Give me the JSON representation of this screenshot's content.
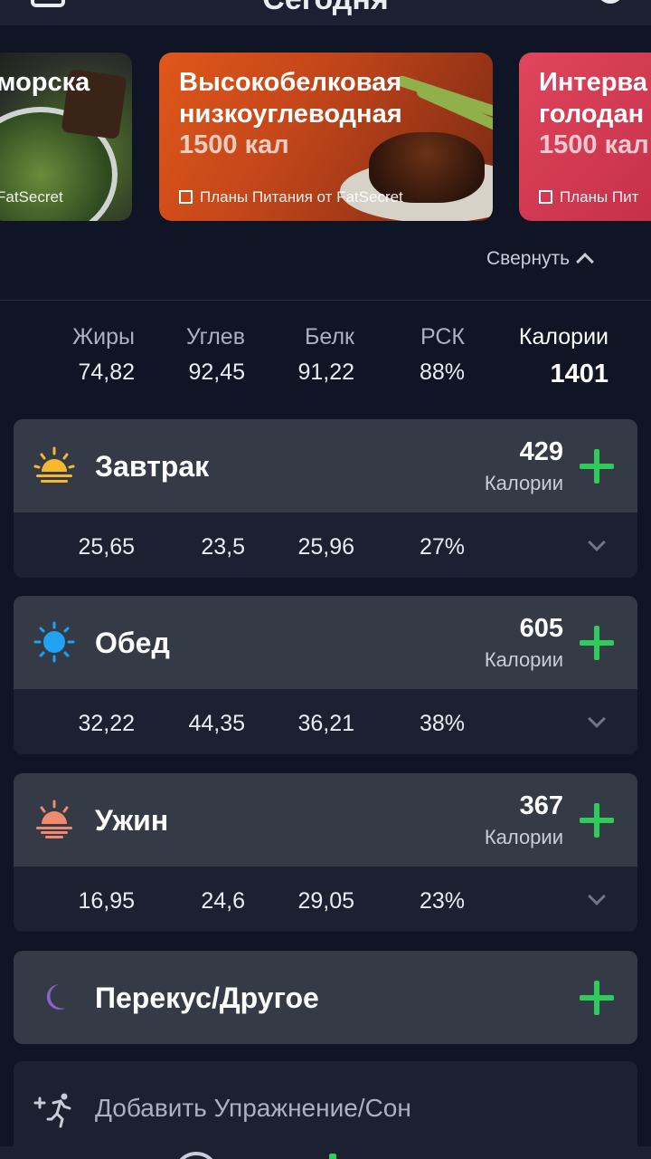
{
  "header": {
    "title": "Сегодня"
  },
  "carousel": [
    {
      "title_line1": "морска",
      "title_line2": "",
      "kcal": "",
      "source": "FatSecret"
    },
    {
      "title_line1": "Высокобелковая",
      "title_line2": "низкоуглеводная",
      "kcal": "1500 кал",
      "source": "Планы Питания от FatSecret"
    },
    {
      "title_line1": "Интерва",
      "title_line2": "голодан",
      "kcal": "1500 кал",
      "source": "Планы Пит"
    }
  ],
  "collapse_label": "Свернуть",
  "totals": {
    "fat_label": "Жиры",
    "fat": "74,82",
    "carbs_label": "Углев",
    "carbs": "92,45",
    "protein_label": "Белк",
    "protein": "91,22",
    "rsk_label": "РСК",
    "rsk": "88%",
    "calories_label": "Калории",
    "calories": "1401"
  },
  "meals": [
    {
      "name": "Завтрак",
      "calories": "429",
      "calories_label": "Калории",
      "fat": "25,65",
      "carbs": "23,5",
      "protein": "25,96",
      "rsk": "27%",
      "icon": "sunrise-icon"
    },
    {
      "name": "Обед",
      "calories": "605",
      "calories_label": "Калории",
      "fat": "32,22",
      "carbs": "44,35",
      "protein": "36,21",
      "rsk": "38%",
      "icon": "sun-icon"
    },
    {
      "name": "Ужин",
      "calories": "367",
      "calories_label": "Калории",
      "fat": "16,95",
      "carbs": "24,6",
      "protein": "29,05",
      "rsk": "23%",
      "icon": "sunset-icon"
    },
    {
      "name": "Перекус/Другое",
      "icon": "moon-icon"
    }
  ],
  "exercise": {
    "label": "Добавить Упражнение/Сон",
    "icon": "add-exercise-icon"
  },
  "colors": {
    "accent_green": "#2ecc5a",
    "background": "#0f1524",
    "card": "#353a47"
  }
}
